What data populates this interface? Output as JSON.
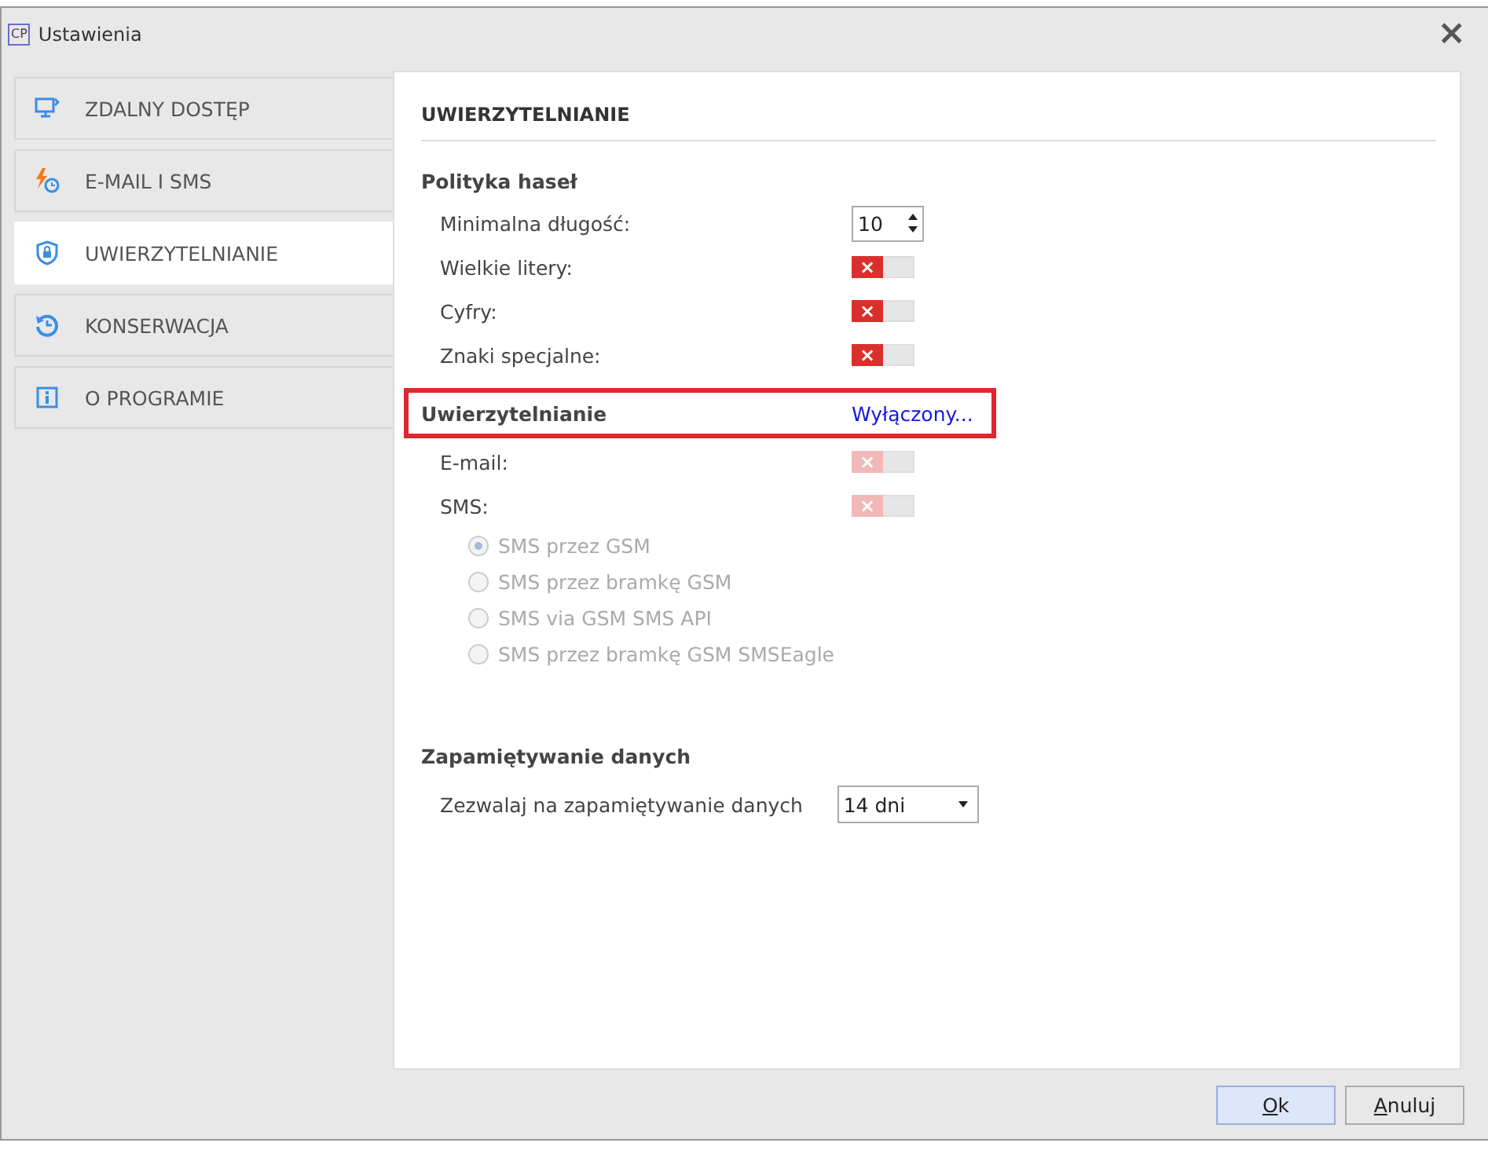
{
  "window": {
    "title": "Ustawienia",
    "logo": "CP",
    "close": "×"
  },
  "sidebar": {
    "items": [
      {
        "label": "ZDALNY DOSTĘP",
        "selected": false
      },
      {
        "label": "E-MAIL I SMS",
        "selected": false
      },
      {
        "label": "UWIERZYTELNIANIE",
        "selected": true
      },
      {
        "label": "KONSERWACJA",
        "selected": false
      },
      {
        "label": "O PROGRAMIE",
        "selected": false
      }
    ]
  },
  "panel": {
    "title": "UWIERZYTELNIANIE",
    "sections": [
      {
        "title": "Polityka haseł",
        "highlighted": false,
        "rows": [
          {
            "kind": "spin",
            "label": "Minimalna długość:",
            "value": "10"
          },
          {
            "kind": "toggle",
            "label": "Wielkie litery:",
            "on": false,
            "disabled": false,
            "off_mark": "×"
          },
          {
            "kind": "toggle",
            "label": "Cyfry:",
            "on": false,
            "disabled": false,
            "off_mark": "×"
          },
          {
            "kind": "toggle",
            "label": "Znaki specjalne:",
            "on": false,
            "disabled": false,
            "off_mark": "×"
          }
        ]
      },
      {
        "title": "Uwierzytelnianie",
        "highlighted": true,
        "link": "Wyłączony...",
        "rows": [
          {
            "kind": "toggle",
            "label": "E-mail:",
            "on": false,
            "disabled": true,
            "off_mark": "×"
          },
          {
            "kind": "toggle",
            "label": "SMS:",
            "on": false,
            "disabled": true,
            "off_mark": "×"
          },
          {
            "kind": "radio",
            "label": "SMS przez GSM",
            "selected": true,
            "disabled": true
          },
          {
            "kind": "radio",
            "label": "SMS przez bramkę GSM",
            "selected": false,
            "disabled": true
          },
          {
            "kind": "radio",
            "label": "SMS via GSM SMS API",
            "selected": false,
            "disabled": true
          },
          {
            "kind": "radio",
            "label": "SMS przez bramkę GSM SMSEagle",
            "selected": false,
            "disabled": true
          }
        ]
      },
      {
        "title": "Zapamiętywanie danych",
        "highlighted": false,
        "rows": [
          {
            "kind": "select",
            "label": "Zezwalaj na zapamiętywanie danych",
            "value": "14 dni"
          }
        ]
      }
    ]
  },
  "buttons": [
    {
      "label": "Ok",
      "default": true
    },
    {
      "label": "Anuluj",
      "default": false
    }
  ]
}
